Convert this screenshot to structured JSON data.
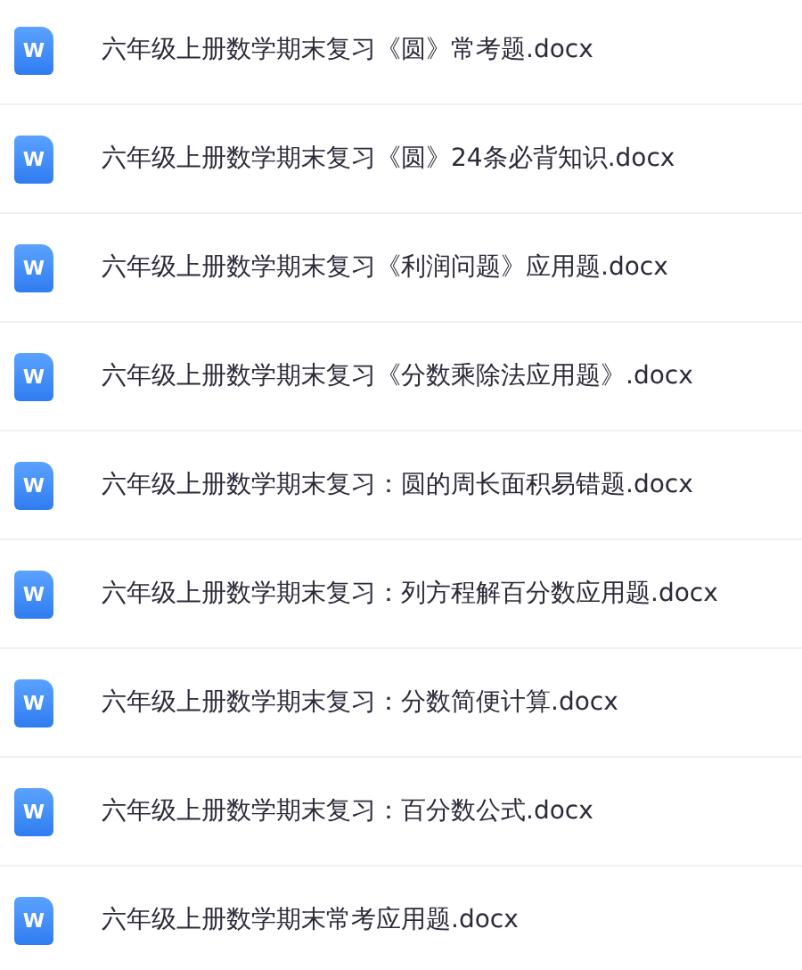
{
  "files": [
    {
      "icon_letter": "W",
      "name": "六年级上册数学期末复习《圆》常考题.docx"
    },
    {
      "icon_letter": "W",
      "name": "六年级上册数学期末复习《圆》24条必背知识.docx"
    },
    {
      "icon_letter": "W",
      "name": "六年级上册数学期末复习《利润问题》应用题.docx"
    },
    {
      "icon_letter": "W",
      "name": "六年级上册数学期末复习《分数乘除法应用题》.docx"
    },
    {
      "icon_letter": "W",
      "name": "六年级上册数学期末复习：圆的周长面积易错题.docx"
    },
    {
      "icon_letter": "W",
      "name": "六年级上册数学期末复习：列方程解百分数应用题.docx"
    },
    {
      "icon_letter": "W",
      "name": "六年级上册数学期末复习：分数简便计算.docx"
    },
    {
      "icon_letter": "W",
      "name": "六年级上册数学期末复习：百分数公式.docx"
    },
    {
      "icon_letter": "W",
      "name": "六年级上册数学期末常考应用题.docx"
    }
  ]
}
